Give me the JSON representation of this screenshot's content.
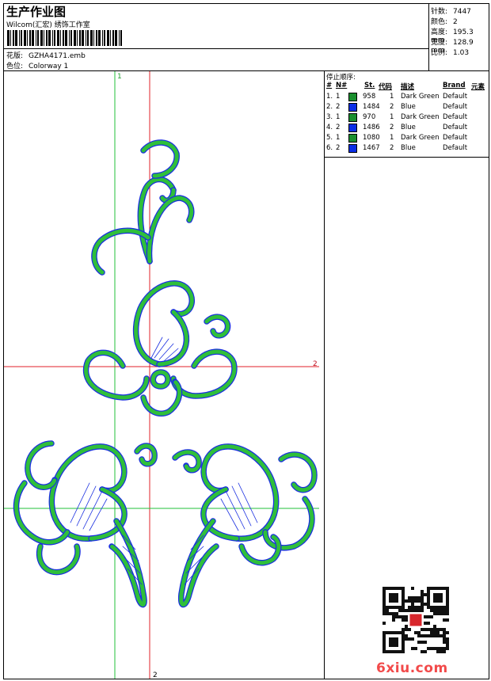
{
  "header": {
    "title": "生产作业图",
    "studio": "Wilcom(汇宏) 绣饰工作室",
    "design_label": "花版:",
    "design_value": "GZHA4171.emb",
    "colorway_label": "色位:",
    "colorway_value": "Colorway 1"
  },
  "stats": [
    {
      "label": "针数:",
      "value": "7447"
    },
    {
      "label": "颜色:",
      "value": "2"
    },
    {
      "label": "高度:",
      "value": "195.3 mm"
    },
    {
      "label": "宽度:",
      "value": "128.9 mm"
    },
    {
      "label": "比例:",
      "value": "1.03"
    }
  ],
  "guides": {
    "top_label": "1",
    "right_label": "2",
    "bottom_label": "2"
  },
  "stop_sequence": {
    "title": "停止顺序:",
    "columns": [
      "#",
      "N#",
      "St.",
      "代码",
      "描述",
      "Brand",
      "元素"
    ],
    "rows": [
      {
        "idx": "1.",
        "n": "1",
        "color": "#1a8f2e",
        "st": "958",
        "code": "1",
        "desc": "Dark Green",
        "brand": "Default"
      },
      {
        "idx": "2.",
        "n": "2",
        "color": "#0a2ee6",
        "st": "1484",
        "code": "2",
        "desc": "Blue",
        "brand": "Default"
      },
      {
        "idx": "3.",
        "n": "1",
        "color": "#1a8f2e",
        "st": "970",
        "code": "1",
        "desc": "Dark Green",
        "brand": "Default"
      },
      {
        "idx": "4.",
        "n": "2",
        "color": "#0a2ee6",
        "st": "1486",
        "code": "2",
        "desc": "Blue",
        "brand": "Default"
      },
      {
        "idx": "5.",
        "n": "1",
        "color": "#1a8f2e",
        "st": "1080",
        "code": "1",
        "desc": "Dark Green",
        "brand": "Default"
      },
      {
        "idx": "6.",
        "n": "2",
        "color": "#0a2ee6",
        "st": "1467",
        "code": "2",
        "desc": "Blue",
        "brand": "Default"
      }
    ]
  },
  "watermark": "6xiu.com",
  "colors": {
    "thread_green": "#2fbf3a",
    "thread_blue": "#1a2fe0",
    "guide_red": "#e0202a",
    "guide_green": "#22c23a"
  },
  "icons": {
    "qr": "qr-code-icon",
    "barcode": "barcode-icon"
  }
}
